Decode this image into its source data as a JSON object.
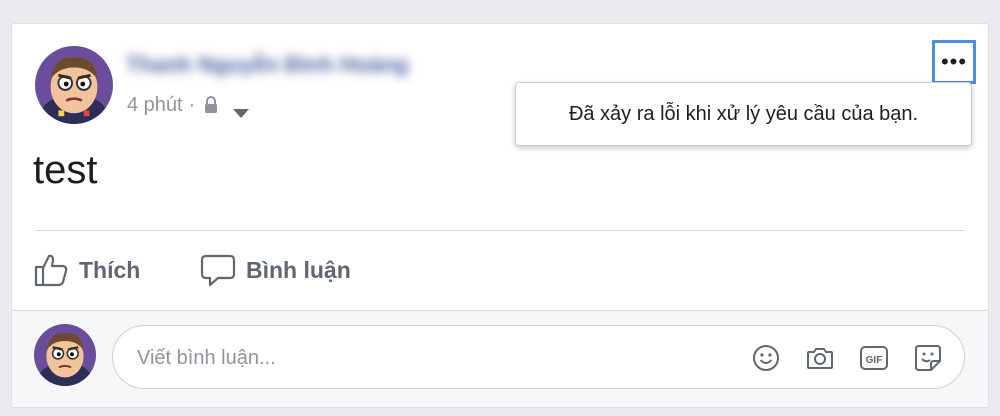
{
  "post": {
    "author_name": "Thanh Nguyễn Đình Hoàng",
    "timestamp": "4 phút",
    "separator": "·",
    "privacy_icon": "lock-icon",
    "content": "test",
    "more_label": "•••"
  },
  "tooltip": {
    "message": "Đã xảy ra lỗi khi xử lý yêu cầu của bạn."
  },
  "actions": {
    "like_label": "Thích",
    "comment_label": "Bình luận"
  },
  "composer": {
    "placeholder": "Viết bình luận...",
    "tools": [
      "emoji-icon",
      "camera-icon",
      "gif-icon",
      "sticker-icon"
    ]
  },
  "colors": {
    "accent": "#4a90e2",
    "meta_text": "#90949c",
    "action_text": "#606770",
    "background": "#e9ebee"
  }
}
